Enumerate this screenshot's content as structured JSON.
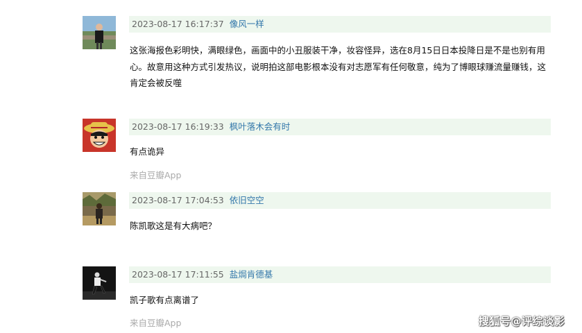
{
  "comments": [
    {
      "time": "2023-08-17 16:17:37",
      "user": "像风一样",
      "text": "这张海报色彩明快，满眼绿色，画面中的小丑服装干净，妆容怪异，选在8月15日日本投降日是不是也别有用心。故意用这种方式引发热议，说明拍这部电影根本没有对志愿军有任何敬意，纯为了博眼球赚流量赚钱，这肯定会被反噬",
      "source": ""
    },
    {
      "time": "2023-08-17 16:19:33",
      "user": "枫叶落木会有时",
      "text": "有点诡异",
      "source": "来自豆瓣App"
    },
    {
      "time": "2023-08-17 17:04:53",
      "user": "依旧空空",
      "text": "陈凯歌这是有大病吧？",
      "source": ""
    },
    {
      "time": "2023-08-17 17:11:55",
      "user": "盐焗肯德基",
      "text": "凯子歌有点离谱了",
      "source": "来自豆瓣App"
    }
  ],
  "watermark": "搜狐号@评综谈影",
  "colors": {
    "meta_background": "#eef7ee",
    "username": "#3377aa",
    "timestamp": "#666666",
    "source": "#aaaaaa"
  }
}
